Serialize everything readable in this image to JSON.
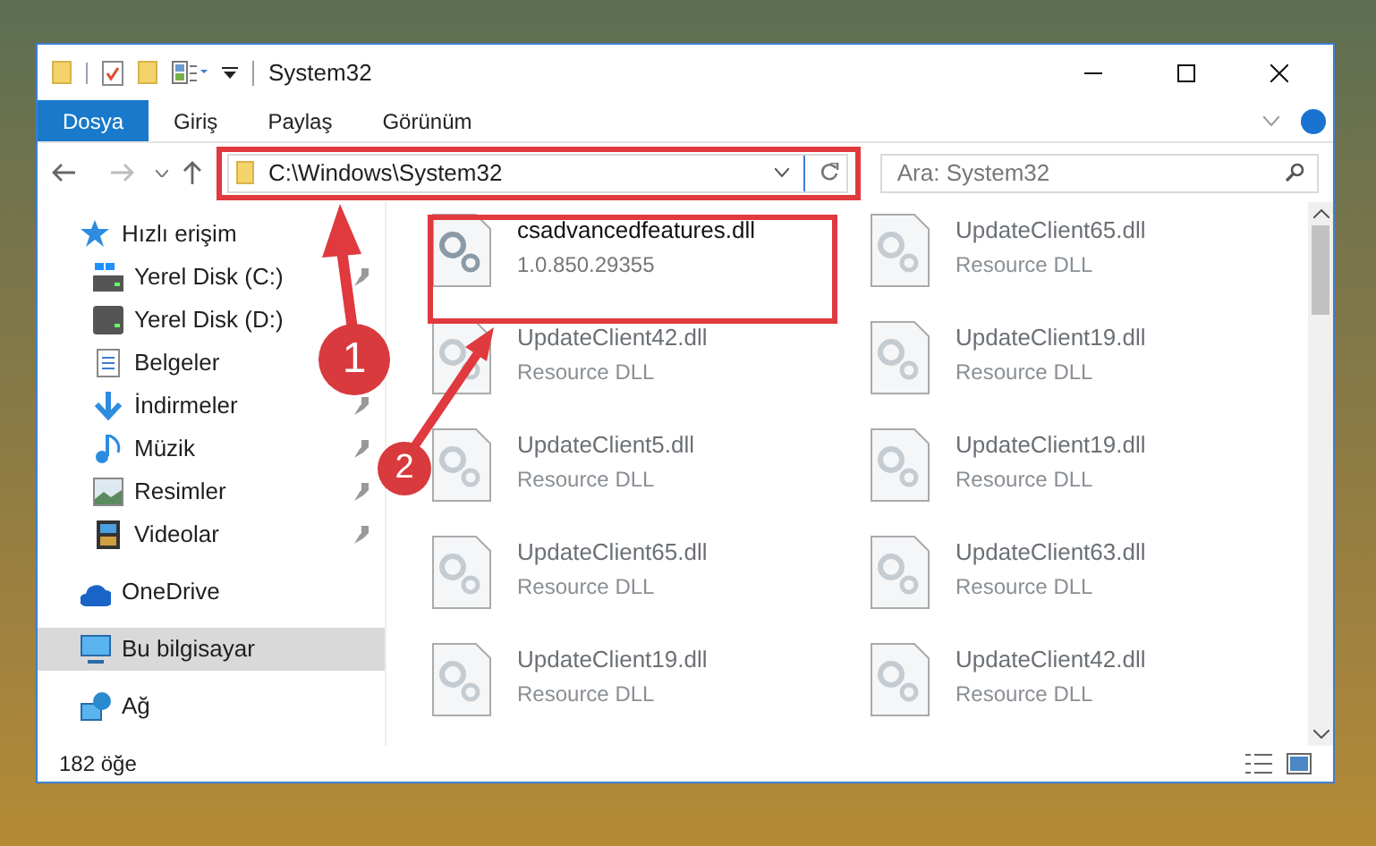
{
  "window": {
    "title": "System32"
  },
  "ribbon_tabs": [
    {
      "label": "Dosya",
      "selected": true
    },
    {
      "label": "Giriş",
      "selected": false
    },
    {
      "label": "Paylaş",
      "selected": false
    },
    {
      "label": "Görünüm",
      "selected": false
    }
  ],
  "address": {
    "path": "C:\\Windows\\System32"
  },
  "search": {
    "placeholder": "Ara: System32"
  },
  "sidebar": {
    "items": [
      {
        "kind": "quick",
        "label": "Hızlı erişim",
        "selected": false,
        "children": [
          {
            "kind": "drive-c",
            "label": "Yerel Disk (C:)",
            "pinned": true,
            "selected": false
          },
          {
            "kind": "drive",
            "label": "Yerel Disk (D:)",
            "selected": false
          },
          {
            "kind": "documents",
            "label": "Belgeler",
            "selected": false
          },
          {
            "kind": "downloads",
            "label": "İndirmeler",
            "pinned": true,
            "selected": false
          },
          {
            "kind": "music",
            "label": "Müzik",
            "pinned": true,
            "selected": false
          },
          {
            "kind": "pictures",
            "label": "Resimler",
            "pinned": true,
            "selected": false
          },
          {
            "kind": "videos",
            "label": "Videolar",
            "pinned": true,
            "selected": false
          }
        ]
      },
      {
        "kind": "cloud",
        "label": "OneDrive",
        "selected": false
      },
      {
        "kind": "pc",
        "label": "Bu bilgisayar",
        "selected": true
      },
      {
        "kind": "network",
        "label": "Ağ",
        "selected": false
      }
    ]
  },
  "files": [
    {
      "name": "csadvancedfeatures.dll",
      "detail": "1.0.850.29355",
      "blurred": false
    },
    {
      "name": "UpdateClient65.dll",
      "detail": "Resource DLL",
      "blurred": true
    },
    {
      "name": "UpdateClient42.dll",
      "detail": "Resource DLL",
      "blurred": true
    },
    {
      "name": "UpdateClient19.dll",
      "detail": "Resource DLL",
      "blurred": true
    },
    {
      "name": "UpdateClient5.dll",
      "detail": "Resource DLL",
      "blurred": true
    },
    {
      "name": "UpdateClient19.dll",
      "detail": "Resource DLL",
      "blurred": true
    },
    {
      "name": "UpdateClient65.dll",
      "detail": "Resource DLL",
      "blurred": true
    },
    {
      "name": "UpdateClient63.dll",
      "detail": "Resource DLL",
      "blurred": true
    },
    {
      "name": "UpdateClient19.dll",
      "detail": "Resource DLL",
      "blurred": true
    },
    {
      "name": "UpdateClient42.dll",
      "detail": "Resource DLL",
      "blurred": true
    }
  ],
  "status_bar": {
    "count": "182 öğe"
  },
  "callouts": [
    {
      "number": "1"
    },
    {
      "number": "2"
    }
  ]
}
